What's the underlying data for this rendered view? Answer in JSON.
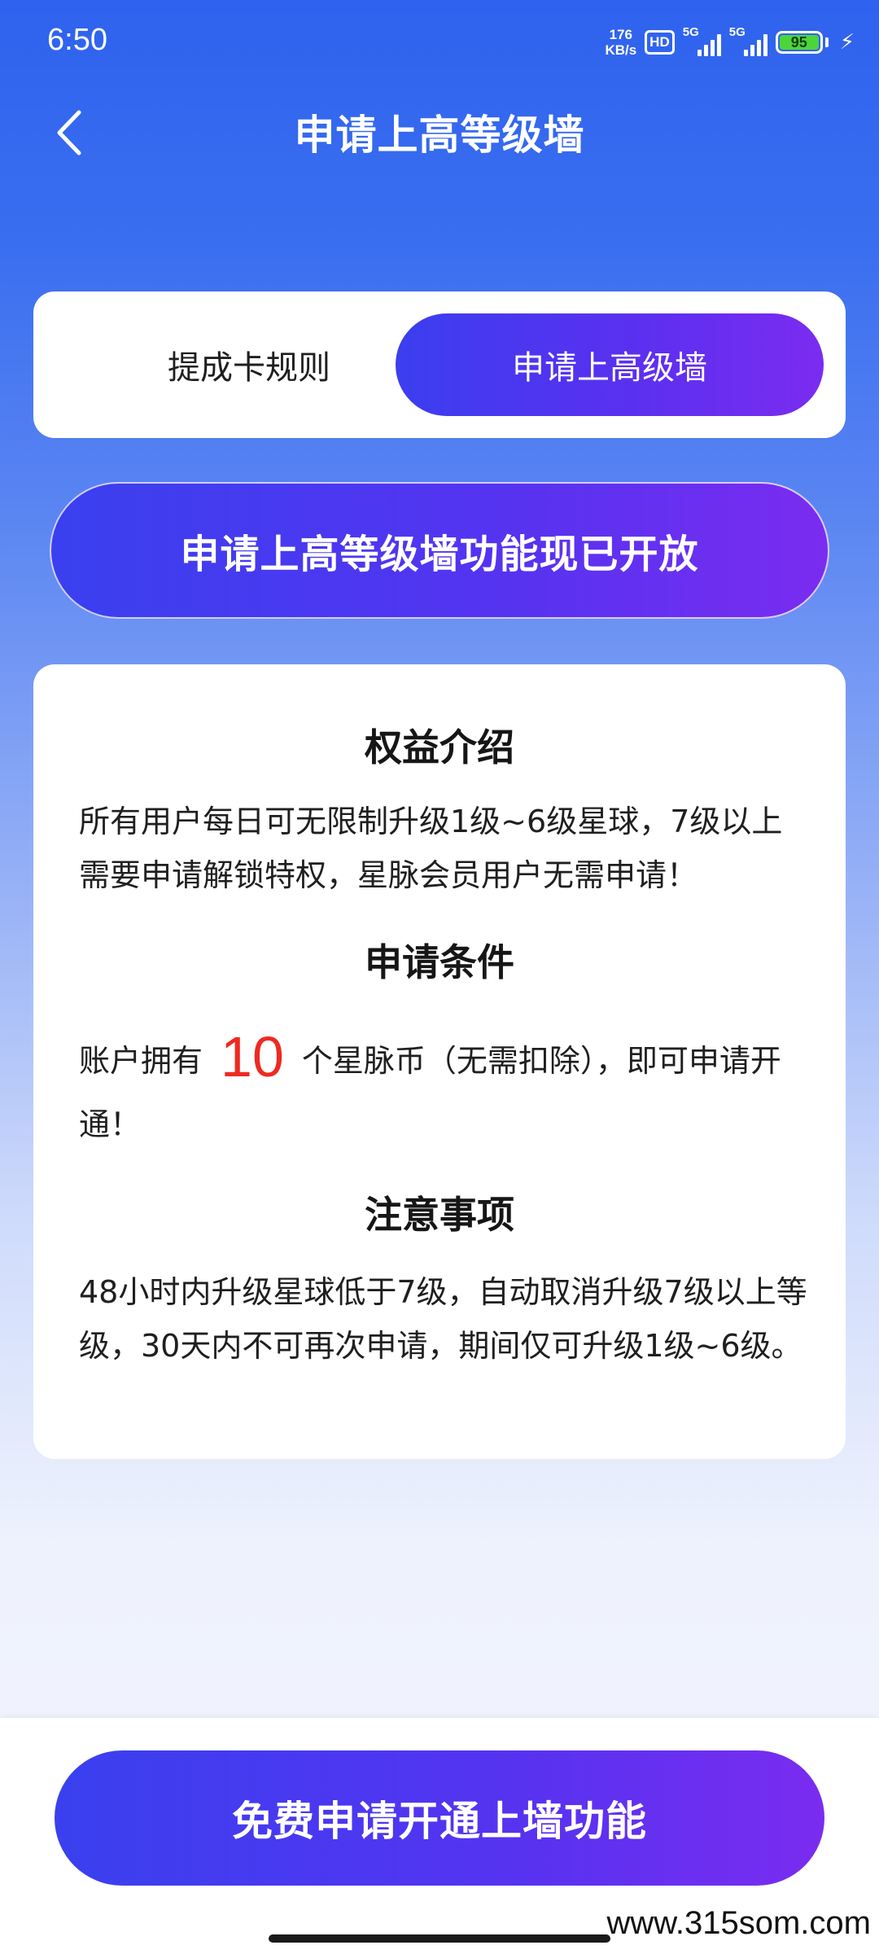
{
  "status_bar": {
    "time": "6:50",
    "net_speed_value": "176",
    "net_speed_unit": "KB/s",
    "hd_label": "HD",
    "sim1_type": "5G",
    "sim2_type": "5G",
    "battery_level": "95"
  },
  "header": {
    "title": "申请上高等级墙"
  },
  "tabs": [
    {
      "label": "提成卡规则",
      "selected": false
    },
    {
      "label": "申请上高级墙",
      "selected": true
    }
  ],
  "banner": {
    "text": "申请上高等级墙功能现已开放"
  },
  "sections": {
    "benefits": {
      "heading": "权益介绍",
      "body": "所有用户每日可无限制升级1级~6级星球，7级以上需要申请解锁特权，星脉会员用户无需申请！"
    },
    "conditions": {
      "heading": "申请条件",
      "body_before": "账户拥有",
      "highlight": "10",
      "body_after": "个星脉币（无需扣除），即可申请开通！"
    },
    "notes": {
      "heading": "注意事项",
      "body": "48小时内升级星球低于7级，自动取消升级7级以上等级，30天内不可再次申请，期间仅可升级1级~6级。"
    }
  },
  "cta": {
    "label": "免费申请开通上墙功能"
  },
  "watermark": "www.315som.com",
  "colors": {
    "accent_start": "#3a40ef",
    "accent_end": "#7a2cf0",
    "highlight": "#ee2a20",
    "battery": "#4cd53b"
  }
}
